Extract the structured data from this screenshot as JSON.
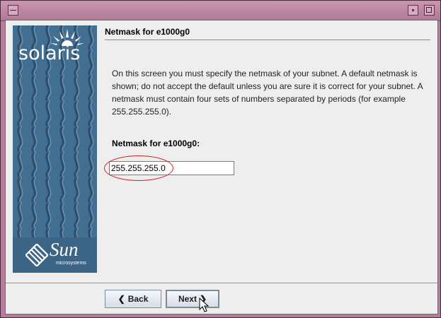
{
  "window": {
    "title": "",
    "controls": [
      "minimize-icon",
      "maximize-icon"
    ]
  },
  "sidebar": {
    "logo_text": "solaris",
    "vendor_logo": "Sun",
    "vendor_sub": "microsystems"
  },
  "page": {
    "header": "Netmask for e1000g0",
    "description": "On this screen you must specify the netmask of your subnet.  A default netmask is shown; do not accept the default unless you are sure it is correct for your subnet. A netmask must contain four sets of numbers separated by periods (for example 255.255.255.0).",
    "field_label": "Netmask for e1000g0:",
    "netmask_value": "255.255.255.0"
  },
  "buttons": {
    "back_label": "Back",
    "next_label": "Next"
  },
  "colors": {
    "frame": "#b87c9c",
    "sidebar": "#3d6a8d",
    "highlight_ring": "#d01b1b"
  }
}
